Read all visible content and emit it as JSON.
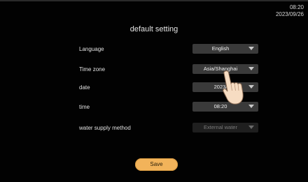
{
  "status": {
    "time": "08:20",
    "date": "2023/09/26"
  },
  "title": "default setting",
  "settings": [
    {
      "label": "Language",
      "value": "English",
      "enabled": true
    },
    {
      "label": "Time zone",
      "value": "Asia/Shanghai",
      "enabled": true
    },
    {
      "label": "date",
      "value": "2023/",
      "enabled": true
    },
    {
      "label": "time",
      "value": "08:20",
      "enabled": true
    },
    {
      "label": "water supply method",
      "value": "External water",
      "enabled": false
    }
  ],
  "save_label": "Save",
  "colors": {
    "accent": "#f2b35a",
    "select_bg": "#3a3a3a",
    "background": "#020202"
  },
  "icons": {
    "dropdown": "chevron-down-icon",
    "pointer": "hand-pointer-icon"
  }
}
